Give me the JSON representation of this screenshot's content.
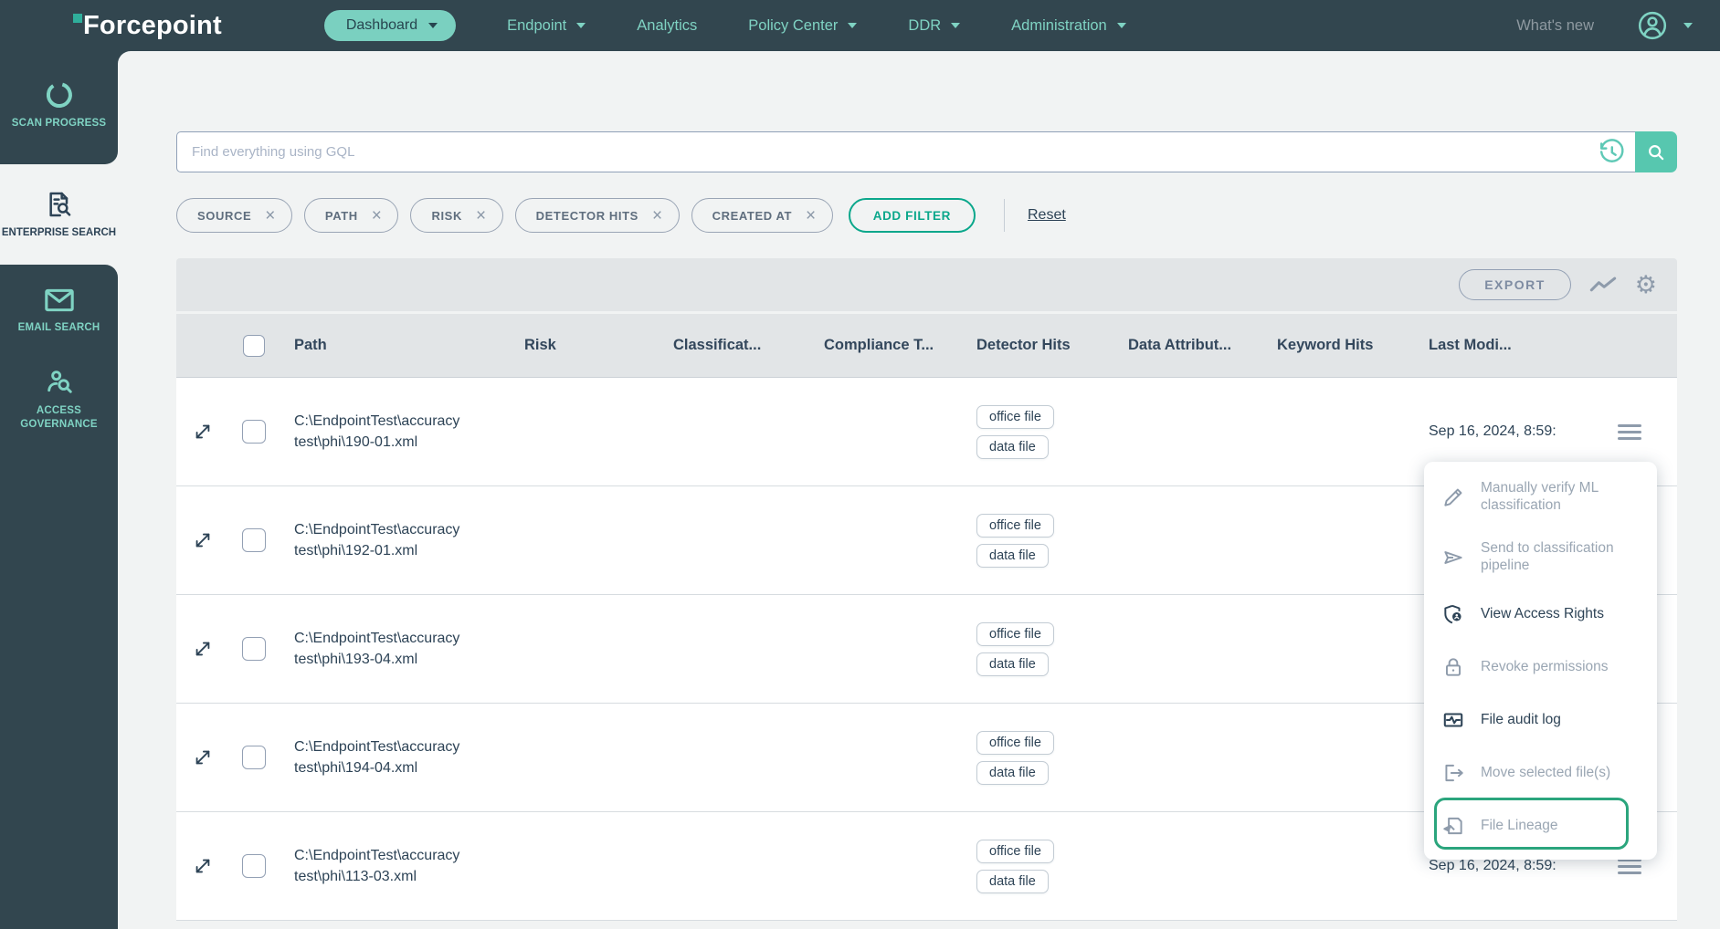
{
  "colors": {
    "nav_dark": "#32464F",
    "teal": "#7FD3C3",
    "accent_green": "#0BA78B",
    "highlight_green": "#2BA57D",
    "search_teal": "#57C7AF",
    "navy_text": "#2D4356",
    "page_bg": "#F1F3F3",
    "band_gray": "#E2E5E7"
  },
  "nav": {
    "brand": "Forcepoint",
    "items": [
      {
        "label": "Dashboard"
      },
      {
        "label": "Endpoint"
      },
      {
        "label": "Analytics"
      },
      {
        "label": "Policy Center"
      },
      {
        "label": "DDR"
      },
      {
        "label": "Administration"
      }
    ],
    "whats_new": "What's new"
  },
  "sidebar": {
    "items": [
      {
        "label": "SCAN PROGRESS"
      },
      {
        "label": "ENTERPRISE SEARCH"
      },
      {
        "label": "EMAIL SEARCH"
      },
      {
        "label": "ACCESS GOVERNANCE"
      }
    ]
  },
  "search": {
    "placeholder": "Find everything using GQL"
  },
  "filters": {
    "chips": [
      {
        "label": "SOURCE"
      },
      {
        "label": "PATH"
      },
      {
        "label": "RISK"
      },
      {
        "label": "DETECTOR HITS"
      },
      {
        "label": "CREATED AT"
      }
    ],
    "add_filter": "ADD FILTER",
    "reset": "Reset"
  },
  "toolbar": {
    "export_label": "EXPORT"
  },
  "table": {
    "columns": {
      "path": "Path",
      "risk": "Risk",
      "classification": "Classificat...",
      "compliance": "Compliance T...",
      "detector_hits": "Detector Hits",
      "data_attributes": "Data Attribut...",
      "keyword_hits": "Keyword Hits",
      "last_modified": "Last Modi..."
    },
    "rows": [
      {
        "path": "C:\\EndpointTest\\accuracy test\\phi\\190-01.xml",
        "tags": [
          "office file",
          "data file"
        ],
        "last_modified": "Sep 16, 2024, 8:59:"
      },
      {
        "path": "C:\\EndpointTest\\accuracy test\\phi\\192-01.xml",
        "tags": [
          "office file",
          "data file"
        ],
        "last_modified": ""
      },
      {
        "path": "C:\\EndpointTest\\accuracy test\\phi\\193-04.xml",
        "tags": [
          "office file",
          "data file"
        ],
        "last_modified": ""
      },
      {
        "path": "C:\\EndpointTest\\accuracy test\\phi\\194-04.xml",
        "tags": [
          "office file",
          "data file"
        ],
        "last_modified": ""
      },
      {
        "path": "C:\\EndpointTest\\accuracy test\\phi\\113-03.xml",
        "tags": [
          "office file",
          "data file"
        ],
        "last_modified": "Sep 16, 2024, 8:59:"
      }
    ]
  },
  "context_menu": {
    "items": [
      {
        "label": "Manually verify ML classification",
        "enabled": false,
        "highlighted": false
      },
      {
        "label": "Send to classification pipeline",
        "enabled": false,
        "highlighted": false
      },
      {
        "label": "View Access Rights",
        "enabled": true,
        "highlighted": false
      },
      {
        "label": "Revoke permissions",
        "enabled": false,
        "highlighted": false
      },
      {
        "label": "File audit log",
        "enabled": true,
        "highlighted": false
      },
      {
        "label": "Move selected file(s)",
        "enabled": false,
        "highlighted": false
      },
      {
        "label": "File Lineage",
        "enabled": false,
        "highlighted": true
      }
    ]
  }
}
